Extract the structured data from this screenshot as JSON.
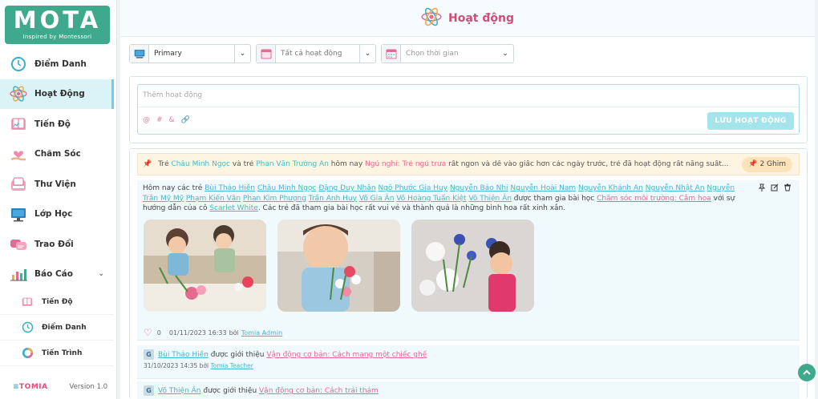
{
  "logo": {
    "title": "MOTA",
    "subtitle": "Inspired by Montessori"
  },
  "sidebar": {
    "items": [
      {
        "label": "Điểm Danh",
        "icon": "clock-icon"
      },
      {
        "label": "Hoạt Động",
        "icon": "atom-icon",
        "active": true
      },
      {
        "label": "Tiến Độ",
        "icon": "book-icon"
      },
      {
        "label": "Chăm Sóc",
        "icon": "care-icon"
      },
      {
        "label": "Thư Viện",
        "icon": "library-icon"
      },
      {
        "label": "Lớp Học",
        "icon": "classroom-icon"
      },
      {
        "label": "Trao Đổi",
        "icon": "chat-icon"
      },
      {
        "label": "Báo Cáo",
        "icon": "report-icon"
      }
    ],
    "sub_items": [
      {
        "label": "Tiến Độ",
        "icon": "book-icon"
      },
      {
        "label": "Điểm Danh",
        "icon": "clock-icon"
      },
      {
        "label": "Tiến Trình",
        "icon": "progress-ring-icon"
      }
    ],
    "footer_brand": "TOMIA",
    "version": "Version 1.0"
  },
  "header": {
    "title": "Hoạt động"
  },
  "filters": {
    "class": "Primary",
    "activity": "Tất cả hoạt động",
    "time_placeholder": "Chọn thời gian"
  },
  "composer": {
    "placeholder": "Thêm hoạt động",
    "tools": [
      "@",
      "#",
      "&",
      "🔗"
    ],
    "save_label": "LƯU HOẠT ĐỘNG"
  },
  "pinned": {
    "p1": "Trẻ ",
    "child1": "Châu Minh Ngọc",
    "p2": " và trẻ ",
    "child2": "Phan Văn Trường An",
    "p3": " hôm nay ",
    "sleep": "Ngủ nghỉ: Trẻ ngủ trưa",
    "p4": " rất ngon và dễ vào giấc hơn các ngày trước, trẻ đã hoạt động rất năng suất...",
    "ghim": "2 Ghim"
  },
  "activity": {
    "intro": "Hôm nay các trẻ ",
    "children": [
      "Bùi Thảo Hiền",
      "Châu Minh Ngọc",
      "Đặng Duy Nhân",
      "Ngô Phước Gia Huy",
      "Nguyễn Bảo Nhi",
      "Nguyễn Hoài Nam",
      "Nguyễn Khánh An",
      "Nguyễn Nhật An",
      "Nguyễn Trần Mỹ Mỹ",
      "Phạm Kiến Văn",
      "Phan Kim Phượng",
      "Trần Anh Huy",
      "Võ Gia Ân",
      "Võ Hoàng Tuấn Kiệt",
      "Võ Thiện Ân"
    ],
    "mid": " được tham gia bài học ",
    "lesson": "Chăm sóc môi trường: Cắm hoa",
    "mid2": " với sự hướng dẫn của cô ",
    "teacher": "Scarlet White",
    "end": ". Các trẻ đã tham gia bài học rất vui vẻ và thành quả là những bình hoa rất xinh xắn.",
    "likes": "0",
    "date": "01/11/2023 16:33",
    "by": "bởi",
    "author": "Tomia Admin"
  },
  "updates": [
    {
      "child": "Bùi Thảo Hiền",
      "verb": " được giới thiệu ",
      "lesson": "Vận động cơ bản: Cách mang một chiếc ghế",
      "date": "31/10/2023 14:35",
      "by": "bởi",
      "author": "Tomia Teacher"
    },
    {
      "child": "Võ Thiện Ân",
      "verb": " được giới thiệu ",
      "lesson": "Vận động cơ bản: Cách trải thảm"
    }
  ],
  "colors": {
    "brand": "#3fa98e",
    "accent_pink": "#e06a92",
    "accent_teal": "#48b7c9"
  }
}
